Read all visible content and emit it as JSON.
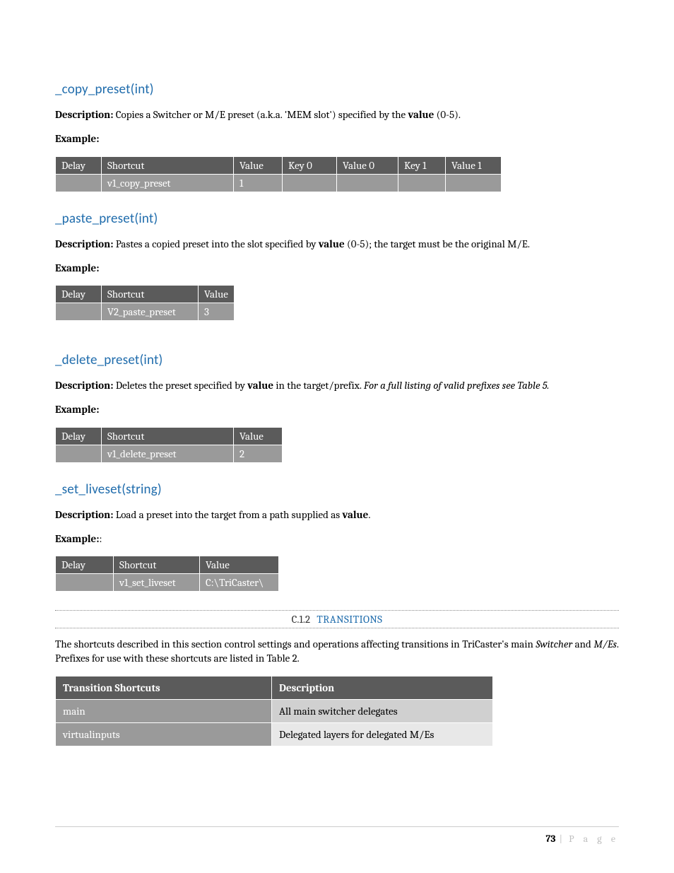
{
  "sections": {
    "copy_preset": {
      "title": "_copy_preset(int)",
      "desc_label": "Description:",
      "desc_before": " Copies a Switcher or M/E preset (a.k.a. 'MEM slot') specified by the ",
      "desc_bold": "value",
      "desc_after": " (0-5).",
      "example_label": "Example:",
      "table": {
        "headers": [
          "Delay",
          "Shortcut",
          "Value",
          "Key 0",
          "Value 0",
          "Key 1",
          "Value 1"
        ],
        "row": [
          "",
          "v1_copy_preset",
          "1",
          "",
          "",
          "",
          ""
        ]
      }
    },
    "paste_preset": {
      "title": "_paste_preset(int)",
      "desc_label": "Description:",
      "desc_before": " Pastes a copied preset into the slot specified by ",
      "desc_bold": "value",
      "desc_after": " (0-5); the target must be the original M/E.",
      "example_label": "Example:",
      "table": {
        "headers": [
          "Delay",
          "Shortcut",
          "Value"
        ],
        "row": [
          "",
          "V2_paste_preset",
          "3"
        ]
      }
    },
    "delete_preset": {
      "title": "_delete_preset(int)",
      "desc_label": "Description:",
      "desc_before": " Deletes the preset specified by ",
      "desc_bold": "value",
      "desc_after": " in the target/prefix. ",
      "desc_ital": "For a full listing of valid prefixes see Table 5.",
      "example_label": "Example:",
      "table": {
        "headers": [
          "Delay",
          "Shortcut",
          "Value"
        ],
        "row": [
          "",
          "v1_delete_preset",
          "2"
        ]
      }
    },
    "set_liveset": {
      "title": "_set_liveset(string)",
      "desc_label": "Description:",
      "desc_before": " Load a preset into the target from a path supplied as ",
      "desc_bold": "value",
      "desc_after": ".",
      "example_label": "Example:",
      "table": {
        "headers": [
          "Delay",
          "Shortcut",
          "Value"
        ],
        "row": [
          "",
          "v1_set_liveset",
          "C:\\TriCaster\\"
        ]
      }
    }
  },
  "transitions": {
    "band_num": "C.1.2",
    "band_title": "TRANSITIONS",
    "intro_1": "The shortcuts described in this section control settings and operations affecting transitions in TriCaster's main ",
    "intro_ital1": "Switcher",
    "intro_mid": " and ",
    "intro_ital2": "M/Es",
    "intro_end": ".  Prefixes for use with these shortcuts are listed in Table 2.",
    "table": {
      "headers": [
        "Transition Shortcuts",
        "Description"
      ],
      "rows": [
        {
          "prefix": "main",
          "desc": "All main switcher delegates"
        },
        {
          "prefix": "virtualinputs",
          "desc": "Delegated layers for delegated M/Es"
        }
      ]
    }
  },
  "footer": {
    "page_number": "73",
    "separator": "|",
    "page_word": "P a g e"
  }
}
